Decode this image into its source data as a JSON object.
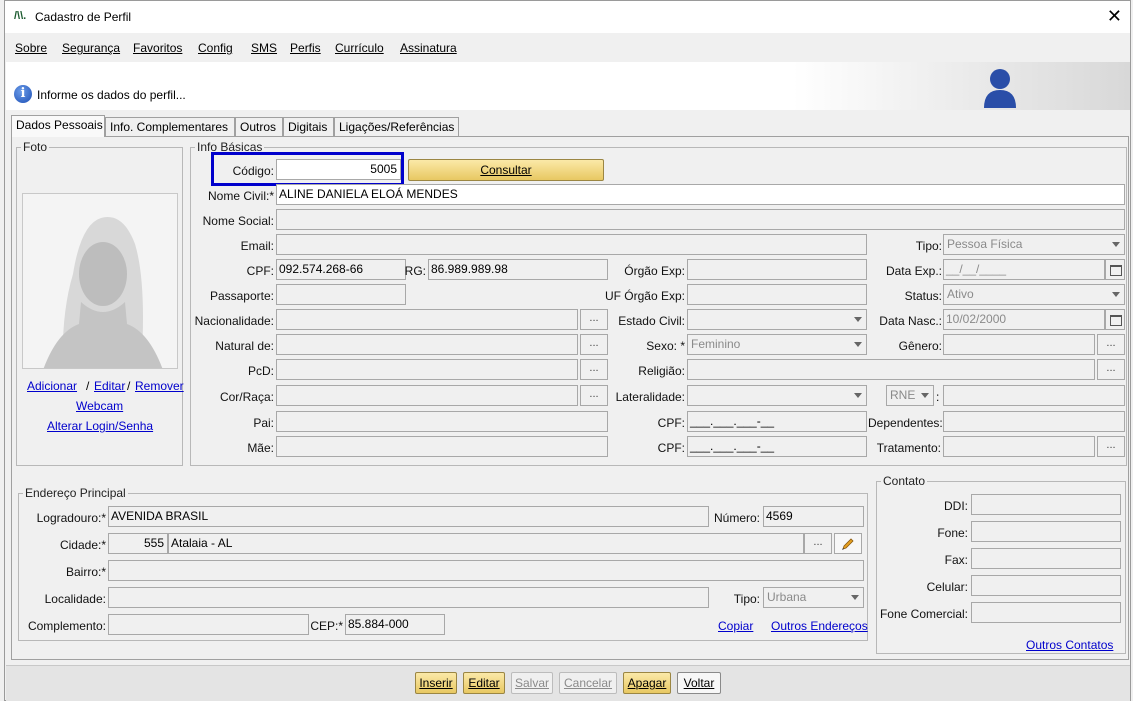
{
  "window": {
    "title": "Cadastro de Perfil"
  },
  "menu": [
    "Sobre",
    "Segurança",
    "Favoritos",
    "Config",
    "SMS",
    "Perfis",
    "Currículo",
    "Assinatura"
  ],
  "info": {
    "text": "Informe os dados do perfil..."
  },
  "tabs": [
    "Dados Pessoais",
    "Info. Complementares",
    "Outros",
    "Digitais",
    "Ligações/Referências"
  ],
  "foto": {
    "legend": "Foto",
    "adicionar": "Adicionar",
    "sep1": "/",
    "editar": "Editar",
    "sep2": "/",
    "remover": "Remover",
    "webcam": "Webcam",
    "alterar_login": "Alterar Login/Senha"
  },
  "info_basicas": {
    "legend": "Info Básicas",
    "codigo_label": "Código:",
    "codigo_value": "5005",
    "consultar_label": "Consultar",
    "nome_civil_label": "Nome Civil:*",
    "nome_civil_value": "ALINE DANIELA ELOÁ MENDES",
    "nome_social_label": "Nome Social:",
    "email_label": "Email:",
    "tipo_label": "Tipo:",
    "tipo_value": "Pessoa Física",
    "cpf_label": "CPF:",
    "cpf_value": "092.574.268-66",
    "rg_label": "RG:",
    "rg_value": "86.989.989.98",
    "orgao_exp_label": "Órgão Exp:",
    "data_exp_label": "Data Exp.:",
    "data_exp_value": "__/__/____",
    "passaporte_label": "Passaporte:",
    "uf_orgao_exp_label": "UF Órgão Exp:",
    "status_label": "Status:",
    "status_value": "Ativo",
    "nacionalidade_label": "Nacionalidade:",
    "estado_civil_label": "Estado Civil:",
    "data_nasc_label": "Data Nasc.:",
    "data_nasc_value": "10/02/2000",
    "natural_de_label": "Natural de:",
    "sexo_label": "Sexo: *",
    "sexo_value": "Feminino",
    "genero_label": "Gênero:",
    "pcd_label": "PcD:",
    "religiao_label": "Religião:",
    "cor_raca_label": "Cor/Raça:",
    "lateralidade_label": "Lateralidade:",
    "rne_value": "RNE",
    "rne_colon": ":",
    "pai_label": "Pai:",
    "cpf_pai_label": "CPF:",
    "cpf_pai_value": "___.___.___-__",
    "dependentes_label": "Dependentes:",
    "mae_label": "Mãe:",
    "cpf_mae_label": "CPF:",
    "cpf_mae_value": "___.___.___-__",
    "tratamento_label": "Tratamento:",
    "ellipsis": "..."
  },
  "endereco": {
    "legend": "Endereço Principal",
    "logradouro_label": "Logradouro:*",
    "logradouro_value": "AVENIDA BRASIL",
    "numero_label": "Número:",
    "numero_value": "4569",
    "cidade_label": "Cidade:*",
    "cidade_code": "555",
    "cidade_value": "Atalaia - AL",
    "bairro_label": "Bairro:*",
    "localidade_label": "Localidade:",
    "tipo_label": "Tipo:",
    "tipo_value": "Urbana",
    "complemento_label": "Complemento:",
    "cep_label": "CEP:*",
    "cep_value": "85.884-000",
    "copiar_label": "Copiar",
    "outros_enderecos_label": "Outros Endereços"
  },
  "contato": {
    "legend": "Contato",
    "ddi_label": "DDI:",
    "fone_label": "Fone:",
    "fax_label": "Fax:",
    "celular_label": "Celular:",
    "fone_comercial_label": "Fone Comercial:",
    "outros_contatos_label": "Outros Contatos"
  },
  "actions": {
    "inserir": "Inserir",
    "editar": "Editar",
    "salvar": "Salvar",
    "cancelar": "Cancelar",
    "apagar": "Apagar",
    "voltar": "Voltar"
  },
  "colors": {
    "highlight_box": "#0000cc",
    "gold_button": "#e8c862",
    "link": "#0000cc"
  }
}
